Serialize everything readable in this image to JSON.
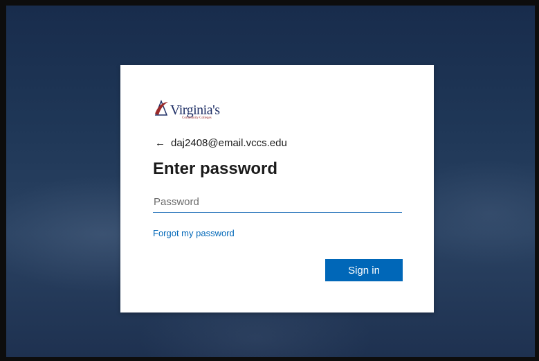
{
  "brand": {
    "name": "Virginia's",
    "subtitle": "Community Colleges",
    "colors": {
      "navy": "#1f2f66",
      "red": "#9a2a2a"
    }
  },
  "identity": {
    "back_icon": "arrow-left-icon",
    "back_glyph": "←",
    "email": "daj2408@email.vccs.edu"
  },
  "title": "Enter password",
  "password": {
    "placeholder": "Password",
    "value": ""
  },
  "forgot_link": "Forgot my password",
  "signin_button": "Sign in",
  "colors": {
    "accent": "#0067b8",
    "card": "#ffffff",
    "background": "#1f3757"
  }
}
